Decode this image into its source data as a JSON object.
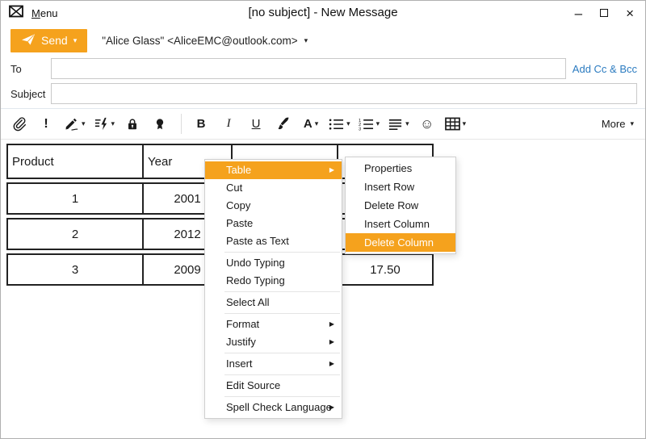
{
  "colors": {
    "accent": "#f5a21d",
    "link": "#2b7bc0",
    "table_border": "#222222"
  },
  "icons": {
    "minimize": "–",
    "close": "×",
    "caret": "▾",
    "submenu_arrow": "▶",
    "emoticon": "☺",
    "bold": "B",
    "italic": "I",
    "underline": "U",
    "font_color": "A",
    "importance": "!"
  },
  "titlebar": {
    "menu_label": "Menu",
    "title": "[no subject] - New Message"
  },
  "send_row": {
    "send_label": "Send",
    "from_account": "\"Alice Glass\" <AliceEMC@outlook.com>"
  },
  "fields": {
    "to_label": "To",
    "to_value": "",
    "add_cc_bcc_label": "Add Cc & Bcc",
    "subject_label": "Subject",
    "subject_value": ""
  },
  "toolbar": {
    "more_label": "More"
  },
  "table": {
    "headers": [
      "Product",
      "Year",
      "",
      ""
    ],
    "rows": [
      [
        "1",
        "2001",
        "",
        ""
      ],
      [
        "2",
        "2012",
        "",
        ""
      ],
      [
        "3",
        "2009",
        "",
        "17.50"
      ]
    ]
  },
  "context_menu": {
    "items": [
      {
        "label": "Table",
        "highlighted": true,
        "has_submenu": true
      },
      {
        "label": "Cut"
      },
      {
        "label": "Copy"
      },
      {
        "label": "Paste"
      },
      {
        "label": "Paste as Text"
      },
      {
        "label": "Undo Typing"
      },
      {
        "label": "Redo Typing"
      },
      {
        "label": "Select All"
      },
      {
        "label": "Format",
        "has_submenu": true
      },
      {
        "label": "Justify",
        "has_submenu": true
      },
      {
        "label": "Insert",
        "has_submenu": true
      },
      {
        "label": "Edit Source"
      },
      {
        "label": "Spell Check Language",
        "has_submenu": true
      }
    ]
  },
  "submenu": {
    "items": [
      "Properties",
      "Insert Row",
      "Delete Row",
      "Insert Column",
      "Delete Column"
    ],
    "highlighted": "Delete Column"
  }
}
